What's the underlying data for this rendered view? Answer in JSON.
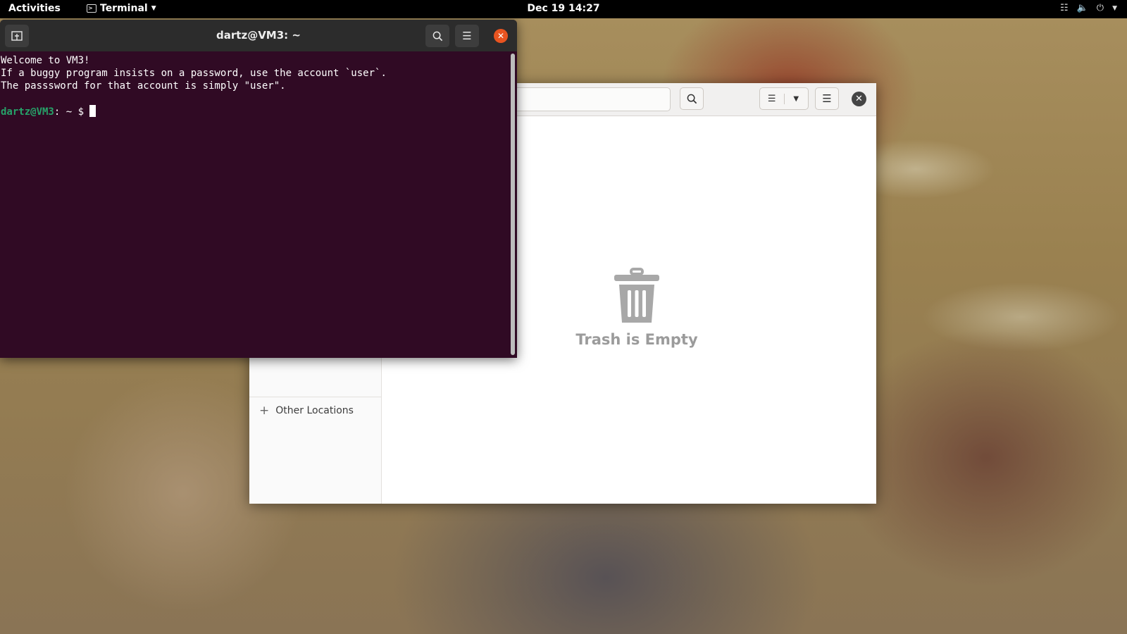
{
  "topbar": {
    "activities": "Activities",
    "app_name": "Terminal",
    "clock": "Dec 19  14:27"
  },
  "terminal": {
    "title": "dartz@VM3: ~",
    "lines": [
      "Welcome to VM3!",
      "If a buggy program insists on a password, use the account `user`.",
      "The passsword for that account is simply \"user\"."
    ],
    "prompt_user": "dartz@VM3",
    "prompt_rest": ": ~ $ ",
    "colors": {
      "background": "#300a24",
      "prompt": "#26a269",
      "close": "#e95420"
    }
  },
  "files": {
    "sidebar": {
      "other_locations": "Other Locations"
    },
    "empty_label": "Trash is Empty"
  },
  "icons": [
    "new-tab-icon",
    "search-icon",
    "hamburger-menu-icon",
    "close-icon",
    "list-view-icon",
    "chevron-down-icon",
    "trash-icon",
    "plus-icon",
    "network-icon",
    "volume-icon",
    "power-icon",
    "terminal-icon"
  ]
}
